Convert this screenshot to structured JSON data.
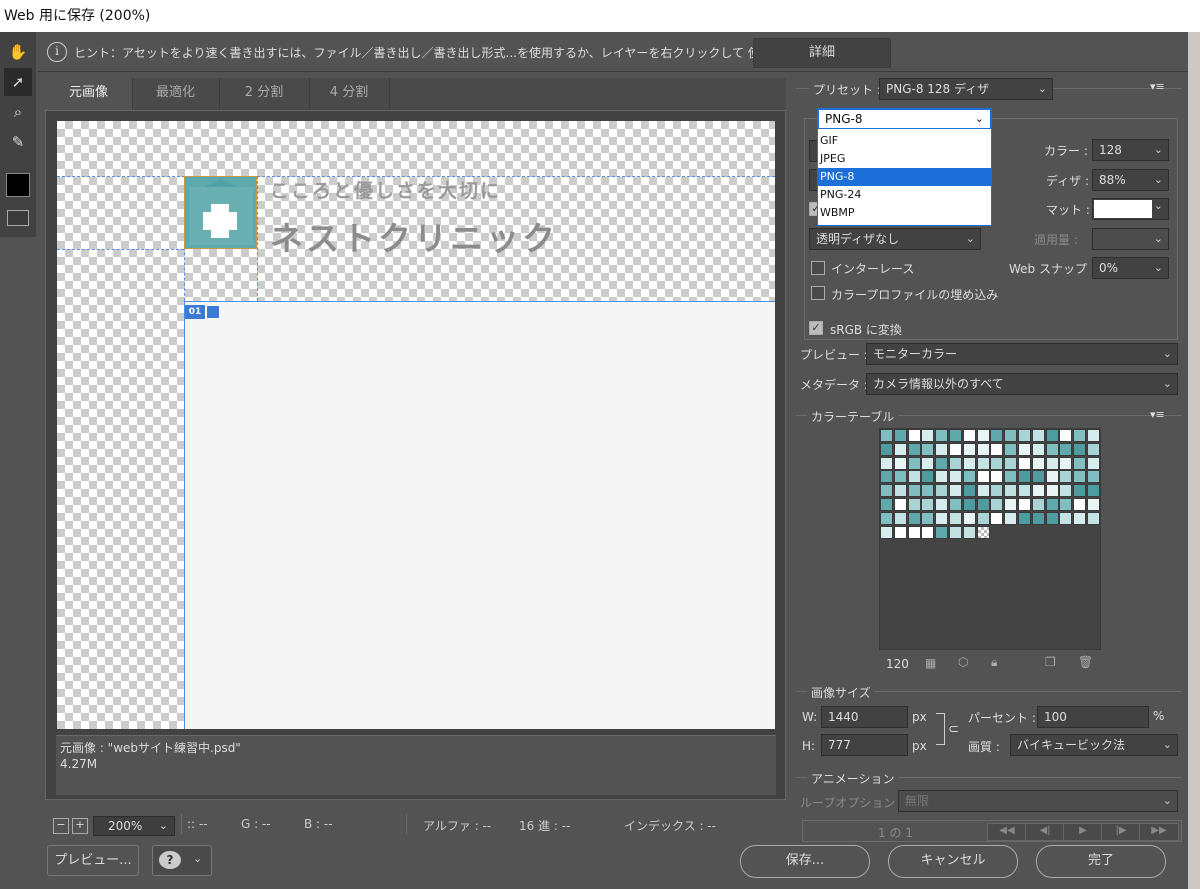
{
  "window": {
    "title": "Web 用に保存 (200%)"
  },
  "hint": {
    "text": "ヒント：アセットをより速く書き出すには、ファイル／書き出し／書き出し形式...を使用するか、レイヤーを右クリックして 使用。",
    "detail_button": "詳細"
  },
  "tabs": [
    "元画像",
    "最適化",
    "2 分割",
    "4 分割"
  ],
  "canvas": {
    "logo_sub": "こころと優しさを大切に",
    "logo_main": "ネストクリニック",
    "slice_badge": "01"
  },
  "image_info": {
    "name": "元画像 : \"webサイト練習中.psd\"",
    "size": "4.27M"
  },
  "status": {
    "zoom": "200%",
    "rgb_r": ":: --",
    "rgb_g": "G : --",
    "rgb_b": "B : --",
    "alpha": "アルファ : --",
    "hex": "16 進 : --",
    "index": "インデックス : --"
  },
  "buttons": {
    "preview": "プレビュー...",
    "save": "保存...",
    "cancel": "キャンセル",
    "done": "完了"
  },
  "preset": {
    "label": "プリセット :",
    "value": "PNG-8 128 ディザ"
  },
  "format": {
    "current": "PNG-8",
    "options": [
      "GIF",
      "JPEG",
      "PNG-8",
      "PNG-24",
      "WBMP"
    ],
    "selected_index": 2
  },
  "settings": {
    "colors_label": "カラー :",
    "colors_value": "128",
    "dither_label": "ディザ :",
    "dither_value": "88%",
    "matte_label": "マット :",
    "transparency_dither": "透明ディザなし",
    "amount_label": "適用量 :",
    "interlace_label": "インターレース",
    "websnap_label": "Web スナップ :",
    "websnap_value": "0%",
    "embed_profile_label": "カラープロファイルの埋め込み",
    "srgb_label": "sRGB に変換",
    "preview_label": "プレビュー :",
    "preview_value": "モニターカラー",
    "metadata_label": "メタデータ :",
    "metadata_value": "カメラ情報以外のすべて"
  },
  "color_table": {
    "title": "カラーテーブル",
    "count": "120"
  },
  "image_size": {
    "title": "画像サイズ",
    "w_label": "W:",
    "w_value": "1440",
    "h_label": "H:",
    "h_value": "777",
    "unit": "px",
    "percent_label": "パーセント :",
    "percent_value": "100",
    "percent_unit": "%",
    "quality_label": "画質 :",
    "quality_value": "バイキュービック法"
  },
  "animation": {
    "title": "アニメーション",
    "loop_label": "ループオプション :",
    "loop_value": "無限",
    "frame": "1 の 1"
  },
  "colors": {
    "accent": "#1c6fd8",
    "teal": "#5fa8ab",
    "panel": "#535353"
  }
}
